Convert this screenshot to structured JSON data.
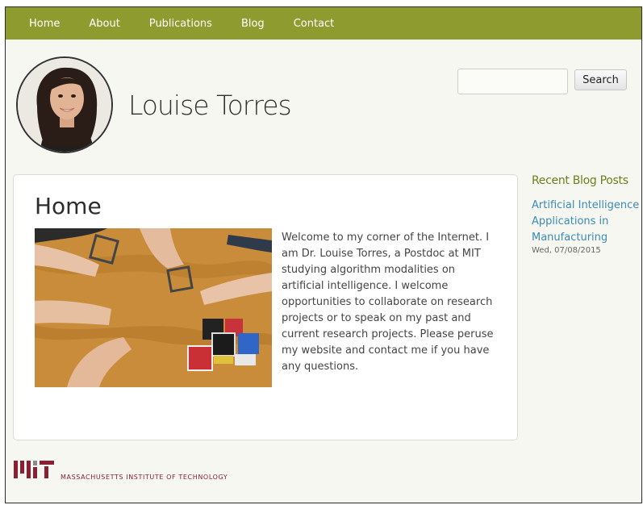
{
  "nav": {
    "items": [
      "Home",
      "About",
      "Publications",
      "Blog",
      "Contact"
    ]
  },
  "header": {
    "site_name": "Louise Torres"
  },
  "search": {
    "value": "",
    "placeholder": "",
    "button_label": "Search"
  },
  "main": {
    "title": "Home",
    "intro": "Welcome to my corner of the Internet. I am Dr. Louise Torres, a Postdoc at MIT studying algorithm modalities on artificial intelligence. I welcome opportunities to collaborate on research projects or to speak on my past and current research projects. Please peruse my website and contact me if you have any questions."
  },
  "sidebar": {
    "title": "Recent Blog Posts",
    "posts": [
      {
        "title": "Artificial Intelligence Applications in Manufacturing",
        "date": "Wed, 07/08/2015"
      }
    ]
  },
  "footer": {
    "logo_text": "MIT",
    "institute": "MASSACHUSETTS INSTITUTE OF TECHNOLOGY"
  },
  "colors": {
    "nav_bg": "#8e9b2e",
    "sidebar_title": "#6d7f1f",
    "link": "#3a8bb5",
    "mit_red": "#8a1f33"
  },
  "icons": {
    "avatar": "profile-photo",
    "hero": "photo-hands-building-cubes",
    "footer": "mit-logo"
  }
}
